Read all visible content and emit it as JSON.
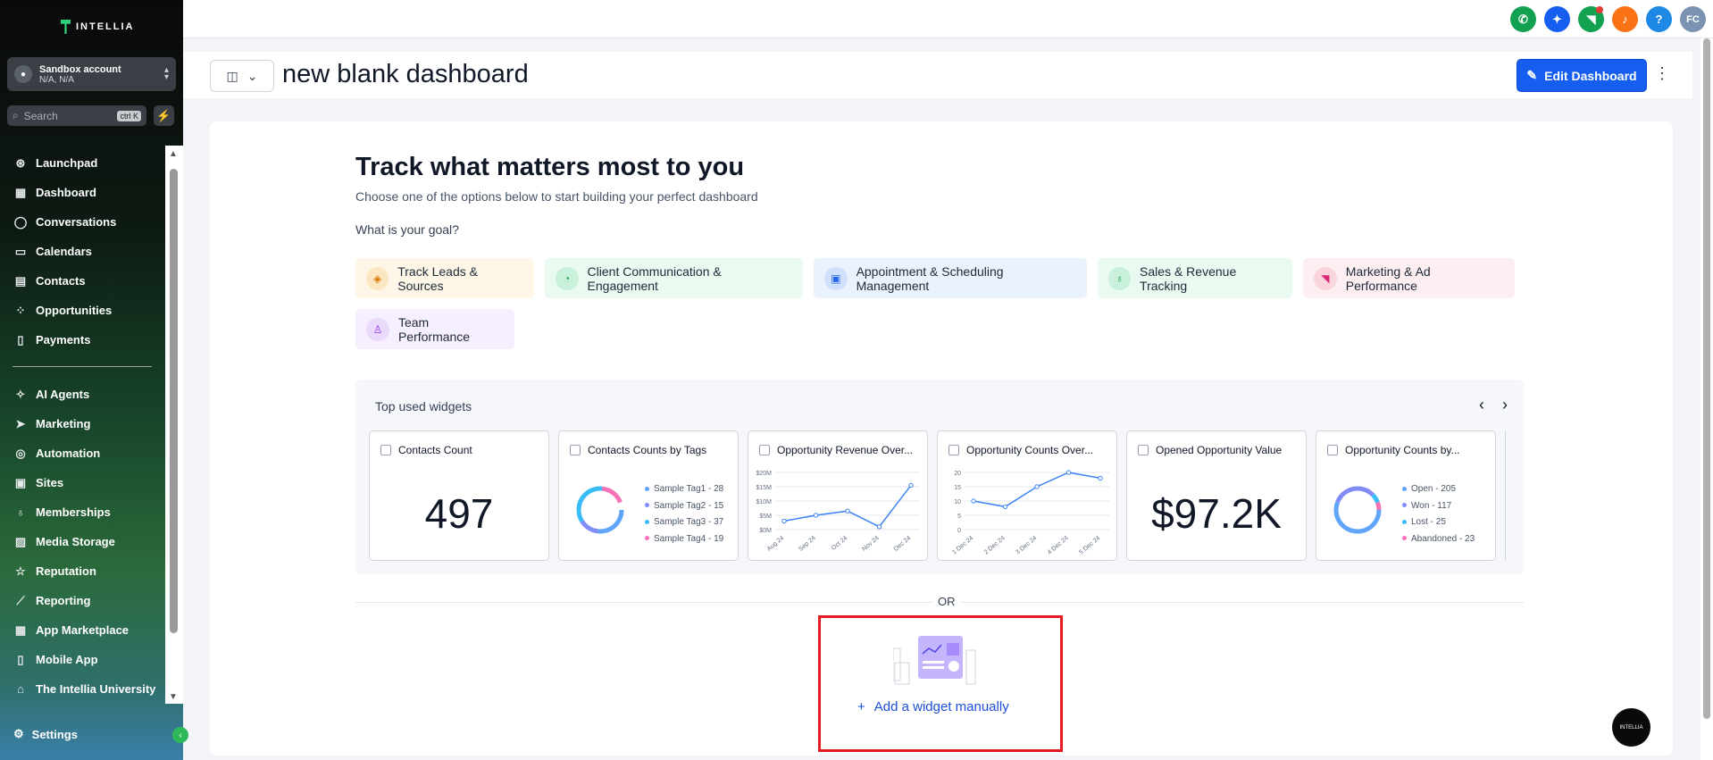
{
  "sidebar": {
    "brand": "INTELLIA",
    "account": {
      "name": "Sandbox account",
      "location": "N/A, N/A"
    },
    "search": {
      "placeholder": "Search",
      "shortcut": "ctrl K"
    },
    "items_main": [
      {
        "label": "Launchpad",
        "icon": "rocket-icon",
        "glyph": "⊛"
      },
      {
        "label": "Dashboard",
        "icon": "grid-icon",
        "glyph": "▦"
      },
      {
        "label": "Conversations",
        "icon": "chat-icon",
        "glyph": "◯"
      },
      {
        "label": "Calendars",
        "icon": "calendar-icon",
        "glyph": "▭"
      },
      {
        "label": "Contacts",
        "icon": "contacts-icon",
        "glyph": "▤"
      },
      {
        "label": "Opportunities",
        "icon": "opportunities-icon",
        "glyph": "⁘"
      },
      {
        "label": "Payments",
        "icon": "payments-icon",
        "glyph": "▯"
      }
    ],
    "items_secondary": [
      {
        "label": "AI Agents",
        "icon": "sparkle-icon",
        "glyph": "✧"
      },
      {
        "label": "Marketing",
        "icon": "send-icon",
        "glyph": "➤"
      },
      {
        "label": "Automation",
        "icon": "automation-icon",
        "glyph": "◎"
      },
      {
        "label": "Sites",
        "icon": "sites-icon",
        "glyph": "▣"
      },
      {
        "label": "Memberships",
        "icon": "award-icon",
        "glyph": "♁"
      },
      {
        "label": "Media Storage",
        "icon": "image-icon",
        "glyph": "▨"
      },
      {
        "label": "Reputation",
        "icon": "star-icon",
        "glyph": "☆"
      },
      {
        "label": "Reporting",
        "icon": "trend-icon",
        "glyph": "⟋"
      },
      {
        "label": "App Marketplace",
        "icon": "apps-icon",
        "glyph": "▦"
      },
      {
        "label": "Mobile App",
        "icon": "mobile-icon",
        "glyph": "▯"
      },
      {
        "label": "The Intellia University",
        "icon": "graduation-icon",
        "glyph": "⌂"
      }
    ],
    "settings": "Settings"
  },
  "topbar": {
    "avatar": "FC",
    "help": "?"
  },
  "header": {
    "title": "new blank dashboard",
    "edit_button": "Edit Dashboard"
  },
  "main": {
    "heading": "Track what matters most to you",
    "subheading": "Choose one of the options below to start building your perfect dashboard",
    "goal_label": "What is your goal?",
    "goals": [
      "Track Leads & Sources",
      "Client Communication & Engagement",
      "Appointment & Scheduling Management",
      "Sales & Revenue Tracking",
      "Marketing & Ad Performance",
      "Team Performance"
    ],
    "widgets_title": "Top used widgets",
    "widgets": [
      {
        "title": "Contacts Count",
        "value": "497"
      },
      {
        "title": "Contacts Counts by Tags",
        "legend": [
          "Sample Tag1 - 28",
          "Sample Tag2 - 15",
          "Sample Tag3 - 37",
          "Sample Tag4 - 19"
        ]
      },
      {
        "title": "Opportunity Revenue Over...",
        "yticks": [
          "$20M",
          "$15M",
          "$10M",
          "$5M",
          "$0M"
        ],
        "xticks": [
          "Aug 24",
          "Sep 24",
          "Oct 24",
          "Nov 24",
          "Dec 24"
        ]
      },
      {
        "title": "Opportunity Counts Over...",
        "yticks": [
          "20",
          "15",
          "10",
          "5",
          "0"
        ],
        "xticks": [
          "1 Dec 24",
          "2 Dec 24",
          "3 Dec 24",
          "4 Dec 24",
          "5 Dec 24"
        ]
      },
      {
        "title": "Opened Opportunity Value",
        "value": "$97.2K"
      },
      {
        "title": "Opportunity Counts by...",
        "legend": [
          "Open - 205",
          "Won - 117",
          "Lost - 25",
          "Abandoned - 23"
        ]
      }
    ],
    "or_label": "OR",
    "add_widget": "Add a widget manually"
  },
  "chart_data": [
    {
      "type": "line",
      "title": "Opportunity Revenue Over...",
      "x": [
        "Aug 24",
        "Sep 24",
        "Oct 24",
        "Nov 24",
        "Dec 24"
      ],
      "x_points": 6,
      "values": [
        3,
        5,
        6.5,
        1,
        15.5
      ],
      "ylim": [
        0,
        20
      ]
    },
    {
      "type": "line",
      "title": "Opportunity Counts Over...",
      "x": [
        "1 Dec 24",
        "2 Dec 24",
        "3 Dec 24",
        "4 Dec 24",
        "5 Dec 24"
      ],
      "values": [
        10,
        8,
        15,
        20,
        18
      ],
      "ylim": [
        0,
        20
      ]
    }
  ],
  "colors": {
    "accent": "#155eef",
    "brand": "#2fd07a",
    "highlight": "#e31b23"
  }
}
